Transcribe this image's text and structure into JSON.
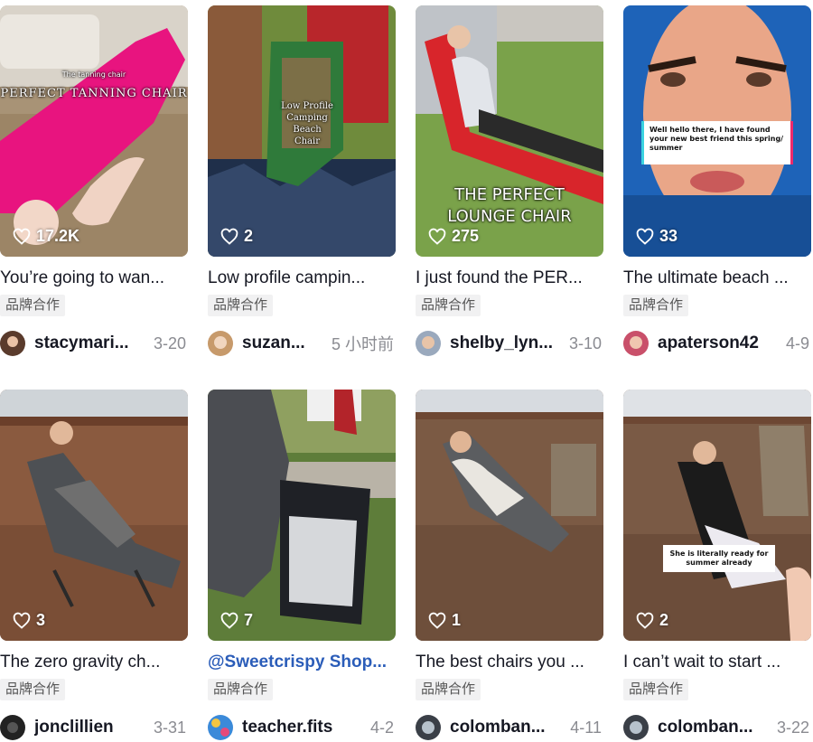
{
  "icons": {
    "like": "heart-outline-icon"
  },
  "videos": [
    {
      "title": "You’re going to wan...",
      "tag": "品牌合作",
      "author": "stacymari...",
      "date": "3-20",
      "likes": "17.2K",
      "overlay_lines": [
        "The tanning chair",
        "PERFECT TANNING CHAIR"
      ],
      "colors": {
        "bg": "#b8a68e",
        "accent": "#e8147f"
      }
    },
    {
      "title": "Low profile campin...",
      "tag": "品牌合作",
      "author": "suzan...",
      "date": "5 小时前",
      "likes": "2",
      "overlay_lines": [
        "Low Profile",
        "Camping",
        "Beach",
        "Chair"
      ],
      "colors": {
        "bg": "#6f8b3c",
        "accent": "#2f7a3a"
      }
    },
    {
      "title": "I just found the PER...",
      "tag": "品牌合作",
      "author": "shelby_lyn...",
      "date": "3-10",
      "likes": "275",
      "overlay_lines": [
        "THE PERFECT",
        "LOUNGE CHAIR"
      ],
      "colors": {
        "bg": "#7aa24a",
        "accent": "#d8252b"
      }
    },
    {
      "title": "The ultimate beach ...",
      "tag": "品牌合作",
      "author": "apaterson42",
      "date": "4-9",
      "likes": "33",
      "overlay_lines": [
        "Well hello there, I have found your new best friend this spring/ summer"
      ],
      "colors": {
        "bg": "#1e63b8",
        "accent": "#e9a688"
      }
    },
    {
      "title": "The zero gravity ch...",
      "tag": "品牌合作",
      "author": "jonclillien",
      "date": "3-31",
      "likes": "3",
      "overlay_lines": [],
      "colors": {
        "bg": "#8a5a3f",
        "accent": "#5c5f63"
      }
    },
    {
      "title": "@Sweetcrispy Shop...",
      "tag": "品牌合作",
      "author": "teacher.fits",
      "date": "4-2",
      "likes": "7",
      "overlay_lines": [],
      "colors": {
        "bg": "#5e7d3a",
        "accent": "#9aa0a6"
      }
    },
    {
      "title": "The best chairs you ...",
      "tag": "品牌合作",
      "author": "colomban...",
      "date": "4-11",
      "likes": "1",
      "overlay_lines": [],
      "colors": {
        "bg": "#7b5a44",
        "accent": "#c8c3bb"
      }
    },
    {
      "title": "I can’t wait to start ...",
      "tag": "品牌合作",
      "author": "colomban...",
      "date": "3-22",
      "likes": "2",
      "overlay_lines": [
        "She is literally ready for summer already"
      ],
      "colors": {
        "bg": "#7a5a45",
        "accent": "#1b1b1b"
      }
    }
  ]
}
